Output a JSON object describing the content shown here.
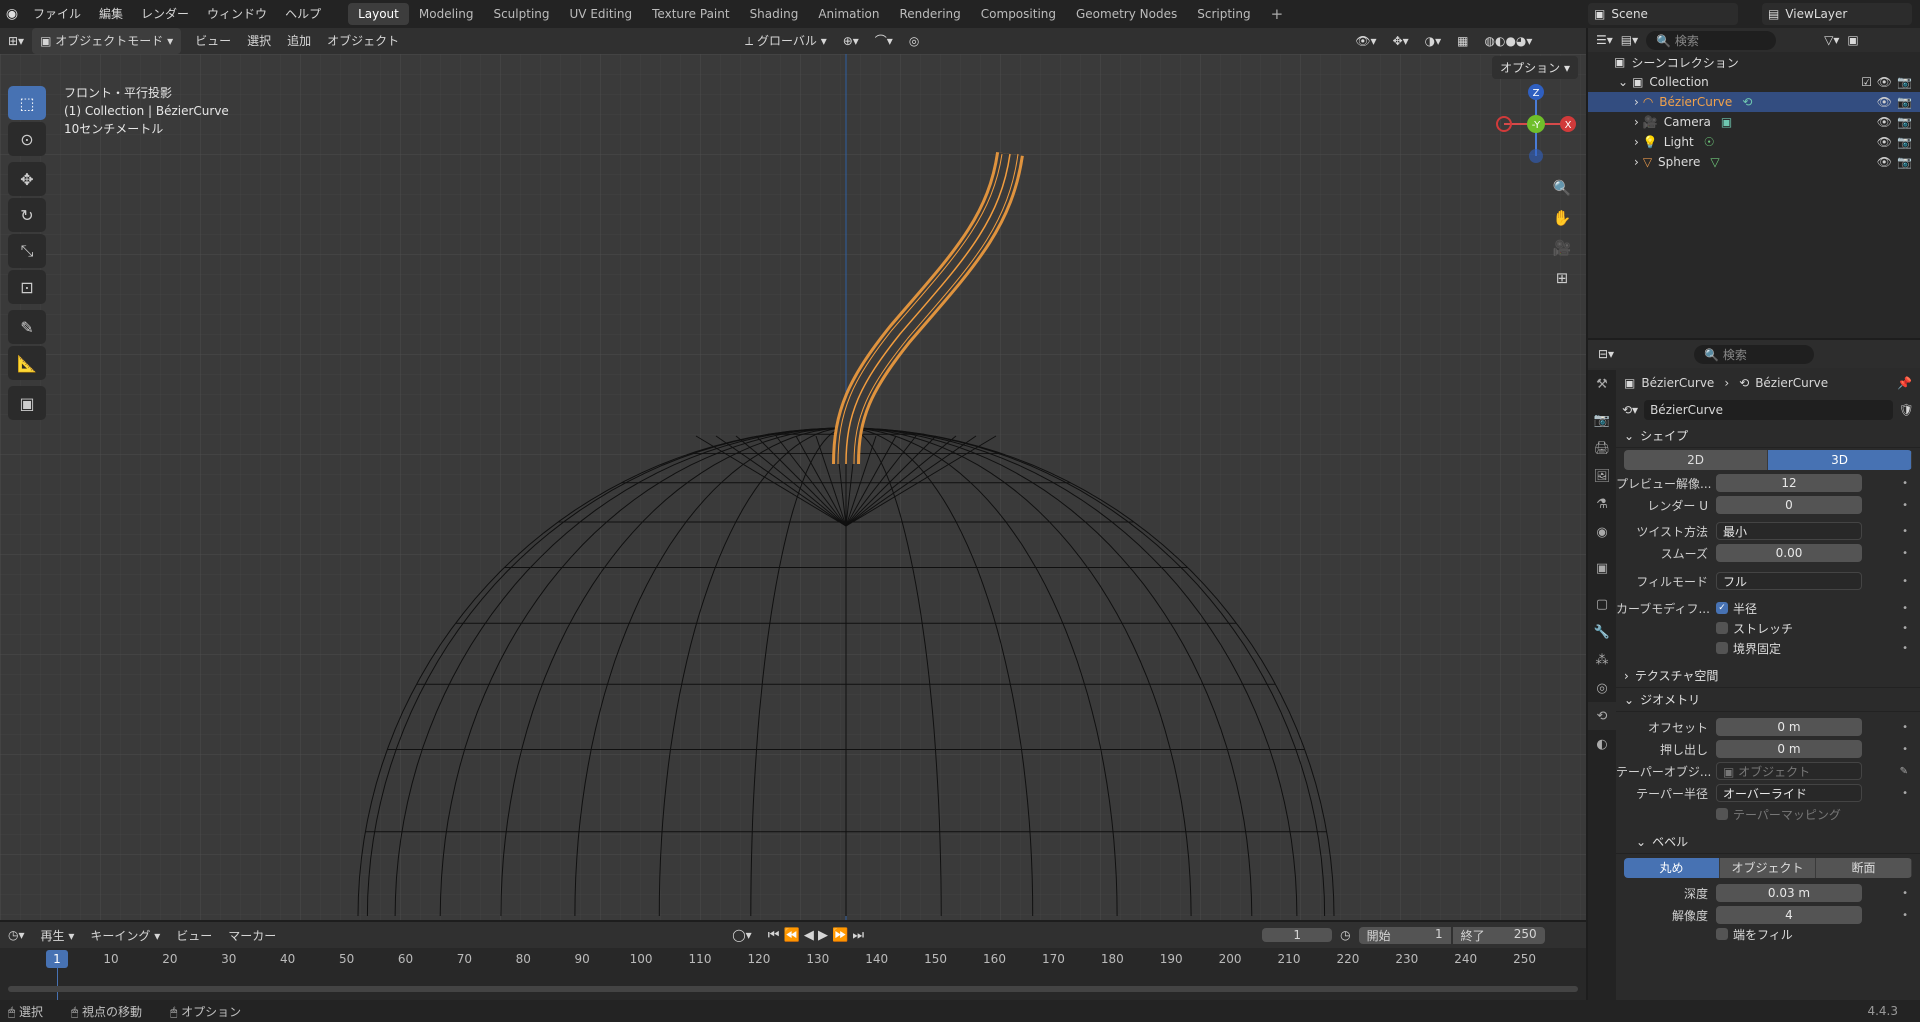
{
  "topbar": {
    "menus": [
      "ファイル",
      "編集",
      "レンダー",
      "ウィンドウ",
      "ヘルプ"
    ],
    "workspaces": [
      "Layout",
      "Modeling",
      "Sculpting",
      "UV Editing",
      "Texture Paint",
      "Shading",
      "Animation",
      "Rendering",
      "Compositing",
      "Geometry Nodes",
      "Scripting"
    ],
    "active_workspace": "Layout",
    "scene": "Scene",
    "view_layer": "ViewLayer"
  },
  "viewport_header": {
    "mode": "オブジェクトモード",
    "menus": [
      "ビュー",
      "選択",
      "追加",
      "オブジェクト"
    ],
    "transform": "グローバル",
    "options": "オプション"
  },
  "viewport": {
    "info_line1": "フロント・平行投影",
    "info_line2": "(1) Collection | BézierCurve",
    "info_line3": "10センチメートル",
    "gizmo": {
      "z": "Z",
      "y": "-Y",
      "x": "X"
    },
    "colors": {
      "selection": "#f29d3f",
      "background": "#3a3a3a",
      "wire": "#000000"
    }
  },
  "outliner": {
    "search_placeholder": "検索",
    "scene_collection": "シーンコレクション",
    "collection": "Collection",
    "items": [
      {
        "name": "BézierCurve",
        "selected": true
      },
      {
        "name": "Camera",
        "selected": false
      },
      {
        "name": "Light",
        "selected": false
      },
      {
        "name": "Sphere",
        "selected": false
      }
    ]
  },
  "properties": {
    "search_placeholder": "検索",
    "breadcrumb_object": "BézierCurve",
    "breadcrumb_data": "BézierCurve",
    "data_name": "BézierCurve",
    "shape_section": "シェイプ",
    "dim_2d": "2D",
    "dim_3d": "3D",
    "preview_res_label": "プレビュー解像...",
    "preview_res_value": "12",
    "render_u_label": "レンダー U",
    "render_u_value": "0",
    "twist_label": "ツイスト方法",
    "twist_value": "最小",
    "smooth_label": "スムーズ",
    "smooth_value": "0.00",
    "fill_label": "フィルモード",
    "fill_value": "フル",
    "curve_deform_label": "カーブモディフ...",
    "radius_label": "半径",
    "stretch_label": "ストレッチ",
    "bounds_label": "境界固定",
    "texture_space_section": "テクスチャ空間",
    "geometry_section": "ジオメトリ",
    "offset_label": "オフセット",
    "offset_value": "0 m",
    "extrude_label": "押し出し",
    "extrude_value": "0 m",
    "taper_obj_label": "テーパーオブジ...",
    "taper_obj_placeholder": "オブジェクト",
    "taper_radius_label": "テーパー半径",
    "taper_radius_value": "オーバーライド",
    "taper_mapping_label": "テーパーマッピング",
    "bevel_section": "ベベル",
    "bevel_round": "丸め",
    "bevel_object": "オブジェクト",
    "bevel_profile": "断面",
    "depth_label": "深度",
    "depth_value": "0.03 m",
    "resolution_label": "解像度",
    "resolution_value": "4",
    "fill_caps_label": "端をフィル"
  },
  "timeline": {
    "menus": [
      "再生",
      "キーイング",
      "ビュー",
      "マーカー"
    ],
    "current_frame": "1",
    "start_label": "開始",
    "start_value": "1",
    "end_label": "終了",
    "end_value": "250",
    "ticks": [
      "10",
      "20",
      "30",
      "40",
      "50",
      "60",
      "70",
      "80",
      "90",
      "100",
      "110",
      "120",
      "130",
      "140",
      "150",
      "160",
      "170",
      "180",
      "190",
      "200",
      "210",
      "220",
      "230",
      "240",
      "250"
    ]
  },
  "statusbar": {
    "select": "選択",
    "move_view": "視点の移動",
    "options": "オプション",
    "version": "4.4.3"
  }
}
